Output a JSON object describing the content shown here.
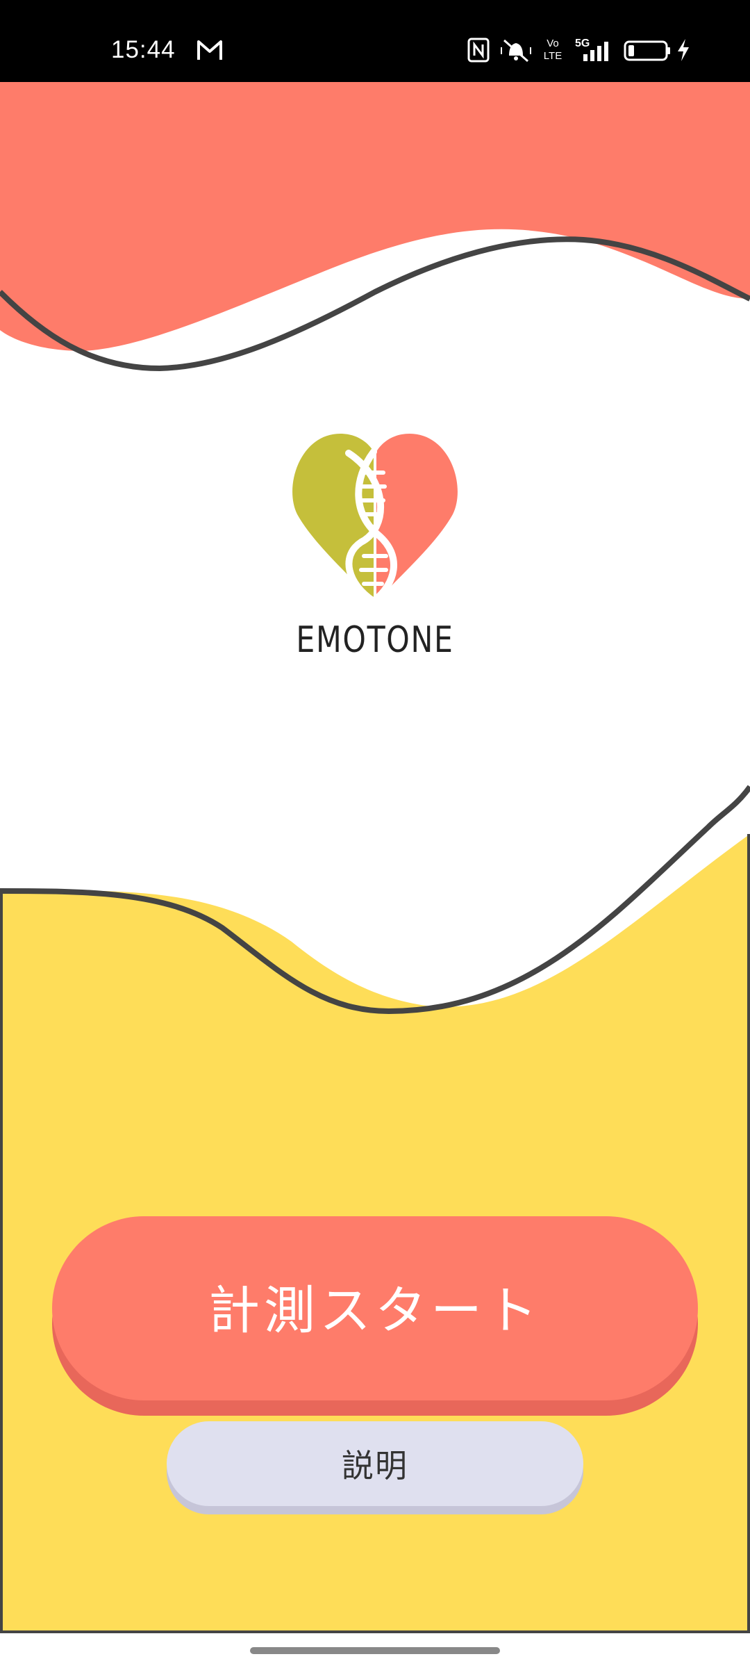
{
  "status_bar": {
    "time": "15:44",
    "left_icons": [
      "gmail-icon"
    ],
    "right_icons": [
      "nfc-icon",
      "vibrate-silent-icon",
      "volte-icon",
      "5g-signal-icon",
      "battery-icon",
      "charging-icon"
    ],
    "network_label": "5G",
    "volte_label": "Vo LTE",
    "battery_level": 0.15
  },
  "app": {
    "brand_name": "EMOTONE",
    "logo_icon": "heart-dna-logo-icon"
  },
  "buttons": {
    "start_label": "計測スタート",
    "explain_label": "説明"
  },
  "colors": {
    "coral": "#fe7c6a",
    "coral_shadow": "#e8675a",
    "yellow": "#fedd58",
    "olive": "#c5bf3b",
    "outline": "#444444",
    "lavender": "#dfe0ef"
  }
}
